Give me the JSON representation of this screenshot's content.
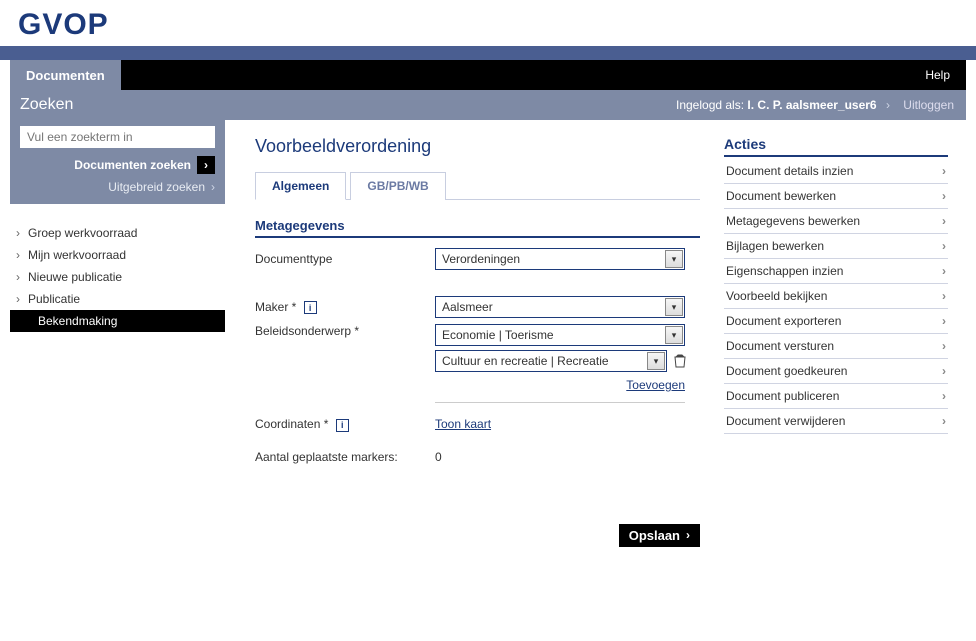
{
  "header": {
    "logo": "GVOP",
    "primary_tab": "Documenten",
    "help": "Help"
  },
  "subheader": {
    "zoeken_title": "Zoeken",
    "logged_in_prefix": "Ingelogd als:",
    "logged_in_user": "I. C. P. aalsmeer_user6",
    "logout": "Uitloggen"
  },
  "search": {
    "placeholder": "Vul een zoekterm in",
    "button": "Documenten zoeken",
    "advanced": "Uitgebreid zoeken"
  },
  "nav": [
    {
      "label": "Groep werkvoorraad",
      "selected": false
    },
    {
      "label": "Mijn werkvoorraad",
      "selected": false
    },
    {
      "label": "Nieuwe publicatie",
      "selected": false
    },
    {
      "label": "Publicatie",
      "selected": false
    },
    {
      "label": "Bekendmaking",
      "selected": true
    }
  ],
  "page": {
    "title": "Voorbeeldverordening",
    "tabs": [
      {
        "label": "Algemeen",
        "active": true
      },
      {
        "label": "GB/PB/WB",
        "active": false
      }
    ],
    "section_metagegevens": "Metagegevens",
    "fields": {
      "documenttype_label": "Documenttype",
      "documenttype_value": "Verordeningen",
      "maker_label": "Maker *",
      "maker_value": "Aalsmeer",
      "beleidsonderwerp_label": "Beleidsonderwerp *",
      "beleidsonderwerp_values": [
        "Economie | Toerisme",
        "Cultuur en recreatie | Recreatie"
      ],
      "toevoegen": "Toevoegen",
      "coordinaten_label": "Coordinaten *",
      "toon_kaart": "Toon kaart",
      "markers_label": "Aantal geplaatste markers:",
      "markers_value": "0"
    },
    "save_button": "Opslaan"
  },
  "actions": {
    "title": "Acties",
    "items": [
      "Document details inzien",
      "Document bewerken",
      "Metagegevens bewerken",
      "Bijlagen bewerken",
      "Eigenschappen inzien",
      "Voorbeeld bekijken",
      "Document exporteren",
      "Document versturen",
      "Document goedkeuren",
      "Document publiceren",
      "Document verwijderen"
    ]
  }
}
